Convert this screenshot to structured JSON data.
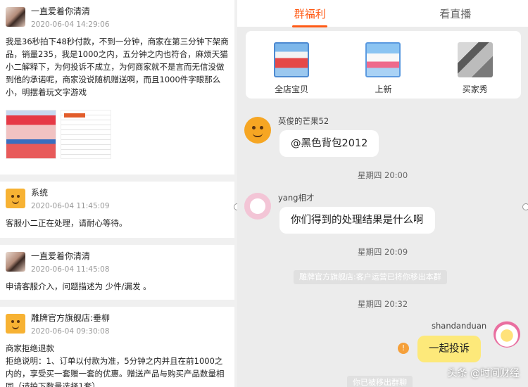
{
  "left": {
    "cards": [
      {
        "name": "一直爱着你清清",
        "time": "2020-06-04 14:29:06",
        "text": "我是36秒拍下48秒付款，不到一分钟，商家在第三分钟下架商品，销量235，我是1000之内，五分钟之内也符合，麻烦天猫小二解释下，为何投诉不成立，为何商家就不是言而无信没做到他的承诺呢，商家没说随机赠送啊，而且1000件字眼那么小，明摆着玩文字游戏"
      },
      {
        "name": "系统",
        "time": "2020-06-04 11:45:09",
        "text": "客服小二正在处理，请耐心等待。"
      },
      {
        "name": "一直爱着你清清",
        "time": "2020-06-04 11:45:08",
        "text": "申请客服介入，问题描述为 少件/漏发 。"
      },
      {
        "name": "雕牌官方旗舰店:垂柳",
        "time": "2020-06-04 09:30:08",
        "text": "商家拒绝退款\n拒绝说明：1、订单以付款为准，5分钟之内并且在前1000之内的，享受买一套赠一套的优惠。赠送产品与购买产品数量相同（请拍下数量选择1套）"
      }
    ]
  },
  "right": {
    "tabs": {
      "welfare": "群福利",
      "live": "看直播"
    },
    "shelf": {
      "all_items": "全店宝贝",
      "new": "上新",
      "buyer_show": "买家秀"
    },
    "chat": {
      "msg1_name": "英俊的芒果52",
      "msg1_text": "@黑色背包2012",
      "stamp1": "星期四 20:00",
      "msg2_name": "yang相才",
      "msg2_text": "你们得到的处理结果是什么啊",
      "stamp2": "星期四 20:09",
      "sys1": "雕牌官方旗舰店:客户运营已将你移出本群",
      "stamp3": "星期四 20:32",
      "msg3_name": "shandanduan",
      "msg3_text": "一起投诉",
      "warn": "!",
      "sys2": "你已被移出群聊"
    },
    "watermark": "头条 @时间财经"
  },
  "colors": {
    "accent": "#ff5b16",
    "bubble_mine": "#fde97a"
  }
}
